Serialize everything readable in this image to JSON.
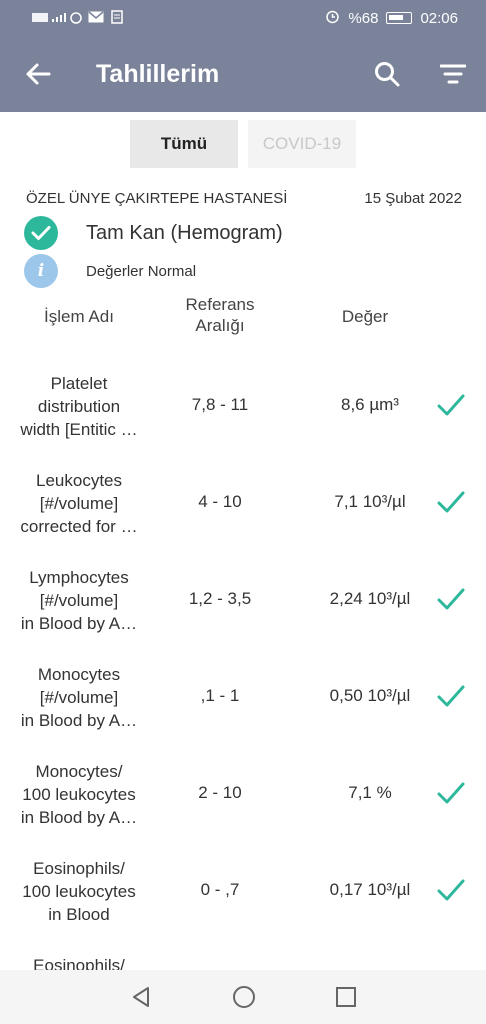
{
  "status_bar": {
    "left_text": "4.5 · .ıl",
    "battery": "%68",
    "time": "02:06"
  },
  "app_bar": {
    "title": "Tahlillerim",
    "icons": [
      "back-arrow-icon",
      "search-icon",
      "filter-icon"
    ]
  },
  "tabs": [
    {
      "label": "Tümü",
      "active": true
    },
    {
      "label": "COVID-19",
      "active": false
    }
  ],
  "report": {
    "hospital": "ÖZEL ÜNYE ÇAKIRTEPE HASTANESİ",
    "date": "15 Şubat 2022",
    "test_name": "Tam Kan (Hemogram)",
    "status": "Değerler Normal"
  },
  "table": {
    "headers": {
      "name": "İşlem Adı",
      "ref_line1": "Referans",
      "ref_line2": "Aralığı",
      "value": "Değer"
    },
    "rows": [
      {
        "name": [
          "Platelet",
          "distribution",
          "width [Entitic …"
        ],
        "ref": "7,8 - 11",
        "value": "8,6 µm³"
      },
      {
        "name": [
          "Leukocytes",
          "[#/volume]",
          "corrected for …"
        ],
        "ref": "4 - 10",
        "value": "7,1 10³/µl"
      },
      {
        "name": [
          "Lymphocytes",
          "[#/volume]",
          "in Blood by A…"
        ],
        "ref": "1,2 - 3,5",
        "value": "2,24 10³/µl"
      },
      {
        "name": [
          "Monocytes",
          "[#/volume]",
          "in Blood by A…"
        ],
        "ref": ",1 - 1",
        "value": "0,50 10³/µl"
      },
      {
        "name": [
          "Monocytes/",
          "100 leukocytes",
          "in Blood by A…"
        ],
        "ref": "2 - 10",
        "value": "7,1 %"
      },
      {
        "name": [
          "Eosinophils/",
          "100 leukocytes",
          "in Blood"
        ],
        "ref": "0 - ,7",
        "value": "0,17 10³/µl"
      },
      {
        "name": [
          "Eosinophils/",
          "",
          ""
        ],
        "ref": "",
        "value": ""
      }
    ]
  },
  "colors": {
    "app_bar": "#7a8399",
    "check": "#2db89c",
    "info": "#9cc6ea"
  }
}
